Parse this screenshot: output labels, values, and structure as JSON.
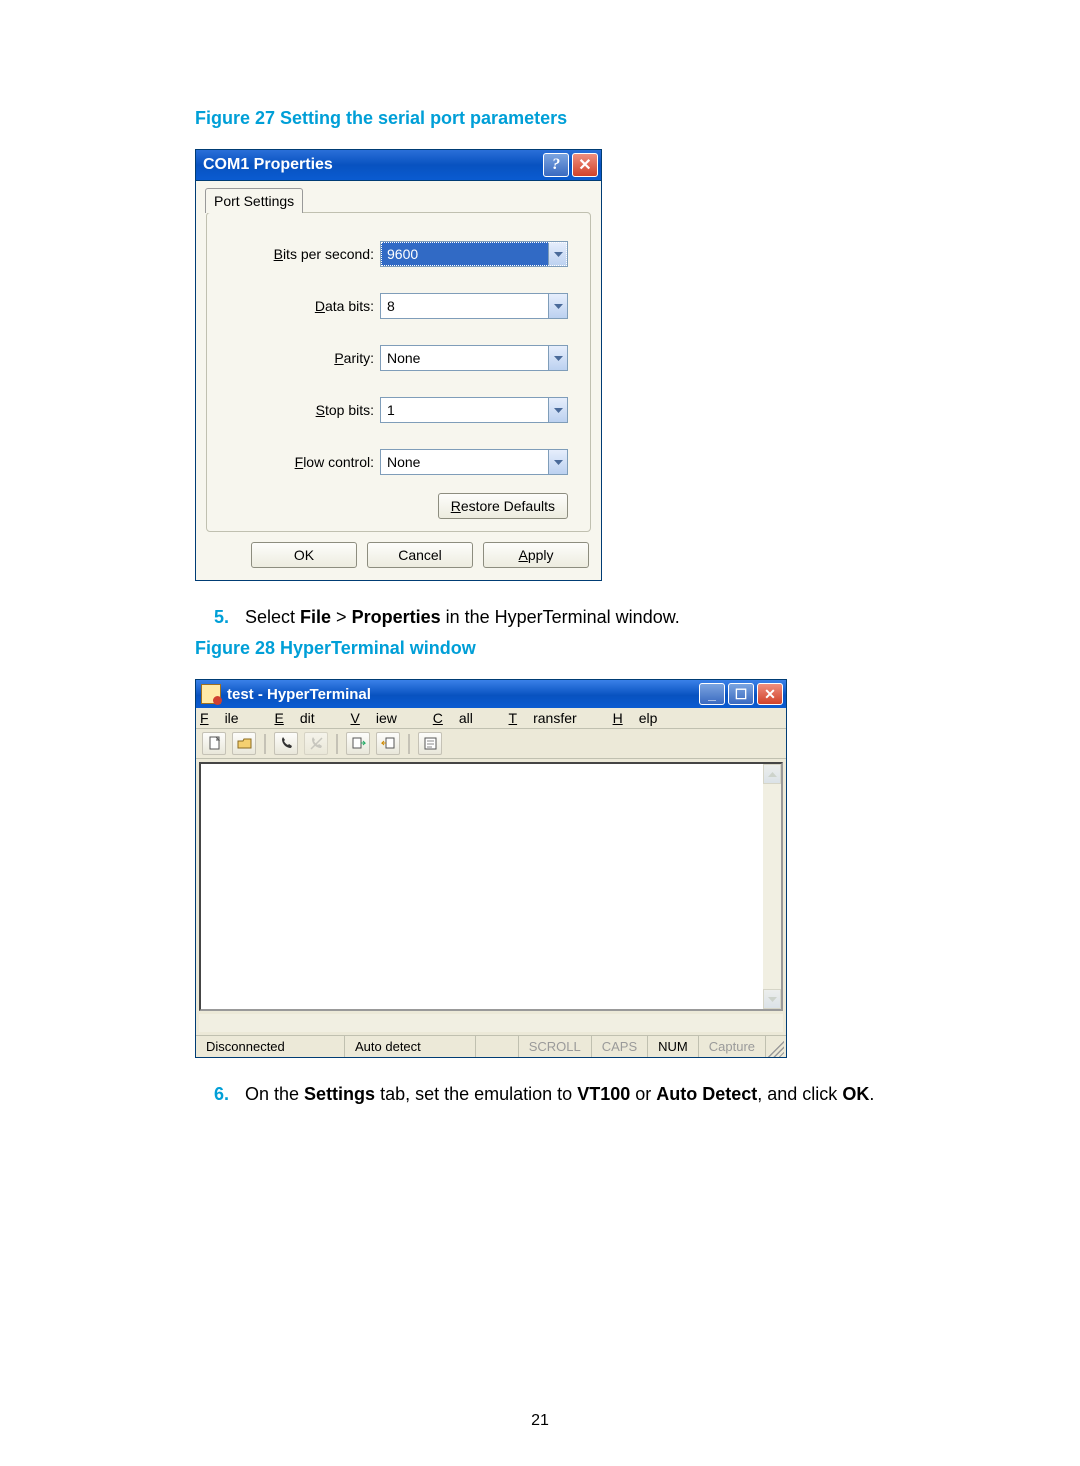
{
  "figure27": {
    "caption": "Figure 27 Setting the serial port parameters"
  },
  "dialog": {
    "title": "COM1 Properties",
    "tab": "Port Settings",
    "fields": {
      "bps": {
        "label_pre": "B",
        "label_rest": "its per second:",
        "value": "9600"
      },
      "data": {
        "label_pre": "D",
        "label_rest": "ata bits:",
        "value": "8"
      },
      "parity": {
        "label_pre": "P",
        "label_rest": "arity:",
        "value": "None"
      },
      "stop": {
        "label_pre": "S",
        "label_rest": "top bits:",
        "value": "1"
      },
      "flow": {
        "label_pre": "F",
        "label_rest": "low control:",
        "value": "None"
      }
    },
    "buttons": {
      "restore_pre": "R",
      "restore_rest": "estore Defaults",
      "ok": "OK",
      "cancel": "Cancel",
      "apply_pre": "A",
      "apply_rest": "pply"
    }
  },
  "step5": {
    "num": "5.",
    "pre": "Select ",
    "b1": "File",
    "mid": " > ",
    "b2": "Properties",
    "post": " in the HyperTerminal window."
  },
  "figure28": {
    "caption": "Figure 28 HyperTerminal window"
  },
  "ht": {
    "title": "test - HyperTerminal",
    "menu": {
      "file_pre": "F",
      "file_rest": "ile",
      "edit_pre": "E",
      "edit_rest": "dit",
      "view_pre": "V",
      "view_rest": "iew",
      "call_pre": "C",
      "call_rest": "all",
      "transfer_pre": "T",
      "transfer_rest": "ransfer",
      "help_pre": "H",
      "help_rest": "elp"
    },
    "status": {
      "conn": "Disconnected",
      "detect": "Auto detect",
      "scroll": "SCROLL",
      "caps": "CAPS",
      "num": "NUM",
      "capture": "Capture"
    }
  },
  "step6": {
    "num": "6.",
    "pre": "On the ",
    "b1": "Settings",
    "mid": " tab, set the emulation to ",
    "b2": "VT100",
    "mid2": " or ",
    "b3": "Auto Detect",
    "mid3": ", and click ",
    "b4": "OK",
    "post": "."
  },
  "page_number": "21"
}
